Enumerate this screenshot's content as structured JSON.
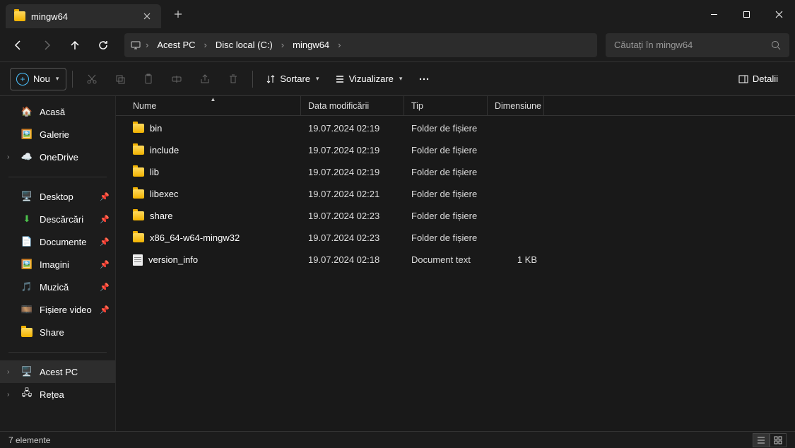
{
  "window": {
    "title": "mingw64"
  },
  "breadcrumbs": [
    "Acest PC",
    "Disc local (C:)",
    "mingw64"
  ],
  "search": {
    "placeholder": "Căutați în mingw64"
  },
  "toolbar": {
    "new": "Nou",
    "sort": "Sortare",
    "view": "Vizualizare",
    "details": "Detalii"
  },
  "columns": {
    "name": "Nume",
    "date": "Data modificării",
    "type": "Tip",
    "size": "Dimensiune"
  },
  "sidebar": {
    "home": "Acasă",
    "gallery": "Galerie",
    "onedrive": "OneDrive",
    "desktop": "Desktop",
    "downloads": "Descărcări",
    "documents": "Documente",
    "pictures": "Imagini",
    "music": "Muzică",
    "videos": "Fișiere video",
    "share": "Share",
    "thispc": "Acest PC",
    "network": "Rețea"
  },
  "rows": [
    {
      "name": "bin",
      "date": "19.07.2024 02:19",
      "type": "Folder de fișiere",
      "size": "",
      "icon": "folder"
    },
    {
      "name": "include",
      "date": "19.07.2024 02:19",
      "type": "Folder de fișiere",
      "size": "",
      "icon": "folder"
    },
    {
      "name": "lib",
      "date": "19.07.2024 02:19",
      "type": "Folder de fișiere",
      "size": "",
      "icon": "folder"
    },
    {
      "name": "libexec",
      "date": "19.07.2024 02:21",
      "type": "Folder de fișiere",
      "size": "",
      "icon": "folder"
    },
    {
      "name": "share",
      "date": "19.07.2024 02:23",
      "type": "Folder de fișiere",
      "size": "",
      "icon": "folder"
    },
    {
      "name": "x86_64-w64-mingw32",
      "date": "19.07.2024 02:23",
      "type": "Folder de fișiere",
      "size": "",
      "icon": "folder"
    },
    {
      "name": "version_info",
      "date": "19.07.2024 02:18",
      "type": "Document text",
      "size": "1 KB",
      "icon": "file"
    }
  ],
  "status": {
    "count": "7 elemente"
  }
}
